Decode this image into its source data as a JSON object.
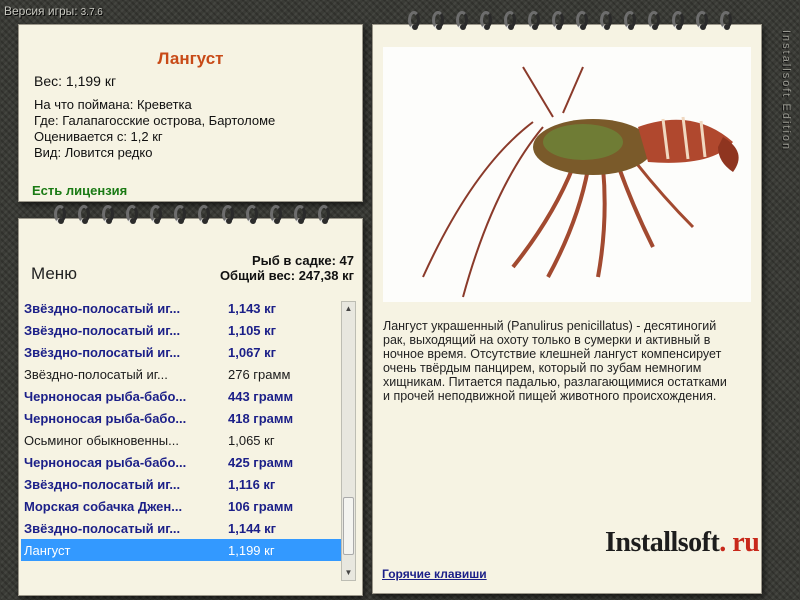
{
  "version": {
    "label": "Версия игры:",
    "number": "3.7.6"
  },
  "brand_vertical": "Installsoft Edition",
  "info": {
    "fish_name": "Лангуст",
    "weight": "Вес: 1,199 кг",
    "bait": "На что поймана: Креветка",
    "location": "Где: Галапагосские острова, Бартоломе",
    "value": "Оценивается с: 1,2 кг",
    "rarity": "Вид: Ловится редко",
    "license": "Есть лицензия"
  },
  "stats": {
    "fish_in_net": "Рыб в садке: 47",
    "total_weight": "Общий вес: 247,38 кг"
  },
  "menu_title": "Меню",
  "catch_list": [
    {
      "name": "Звёздно-полосатый иг...",
      "weight": "1,143 кг",
      "style": "bold"
    },
    {
      "name": "Звёздно-полосатый иг...",
      "weight": "1,105 кг",
      "style": "bold"
    },
    {
      "name": "Звёздно-полосатый иг...",
      "weight": "1,067 кг",
      "style": "bold"
    },
    {
      "name": "Звёздно-полосатый иг...",
      "weight": "276 грамм",
      "style": "plain"
    },
    {
      "name": "Черноносая рыба-бабо...",
      "weight": "443 грамм",
      "style": "bold"
    },
    {
      "name": "Черноносая рыба-бабо...",
      "weight": "418 грамм",
      "style": "bold"
    },
    {
      "name": "Осьминог обыкновенны...",
      "weight": "1,065 кг",
      "style": "plain"
    },
    {
      "name": "Черноносая рыба-бабо...",
      "weight": "425 грамм",
      "style": "bold"
    },
    {
      "name": "Звёздно-полосатый иг...",
      "weight": "1,116 кг",
      "style": "bold"
    },
    {
      "name": "Морская собачка Джен...",
      "weight": "106 грамм",
      "style": "bold"
    },
    {
      "name": "Звёздно-полосатый иг...",
      "weight": "1,144 кг",
      "style": "bold"
    },
    {
      "name": "Лангуст",
      "weight": "1,199 кг",
      "style": "sel"
    }
  ],
  "description": "Лангуст украшенный (Panulirus penicillatus) - десятиногий рак, выходящий на охоту только в сумерки и активный в ночное время. Отсутствие клешней лангуст компенсирует очень твёрдым панцирем, который по зубам немногим хищникам. Питается падалью, разлагающимися остатками и прочей неподвижной пищей животного происхождения.",
  "hotkeys_label": "Горячие клавиши",
  "watermark": {
    "main": "Installsoft",
    "dot": ".",
    "ru": "ru"
  },
  "colors": {
    "title": "#c84a17",
    "list_bold": "#1b1f88",
    "selected": "#3399ff",
    "license": "#1a7a14"
  }
}
